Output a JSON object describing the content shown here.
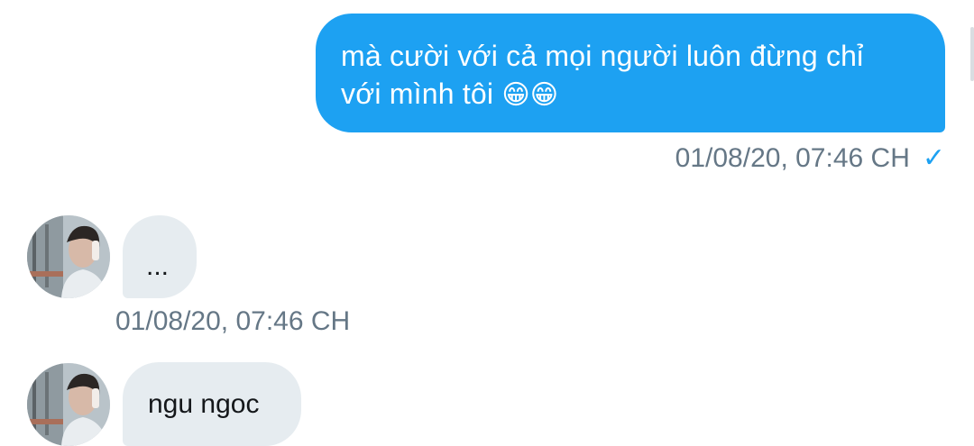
{
  "conversation": {
    "messages": [
      {
        "direction": "outgoing",
        "text": "mà cười với cả mọi người luôn đừng chỉ với mình tôi",
        "line1": "mà cười với cả mọi người luôn đừng chỉ",
        "line2": "với mình tôi",
        "emojis": "😁😁",
        "timestamp": "01/08/20, 07:46 CH",
        "status": "sent"
      },
      {
        "direction": "incoming",
        "text": "...",
        "timestamp": "01/08/20, 07:46 CH"
      },
      {
        "direction": "incoming",
        "text": "ngu ngoc"
      }
    ],
    "status_icon": "✓",
    "colors": {
      "outgoing_bubble": "#1da1f2",
      "incoming_bubble": "#e6ecf0",
      "timestamp": "#657786"
    }
  }
}
